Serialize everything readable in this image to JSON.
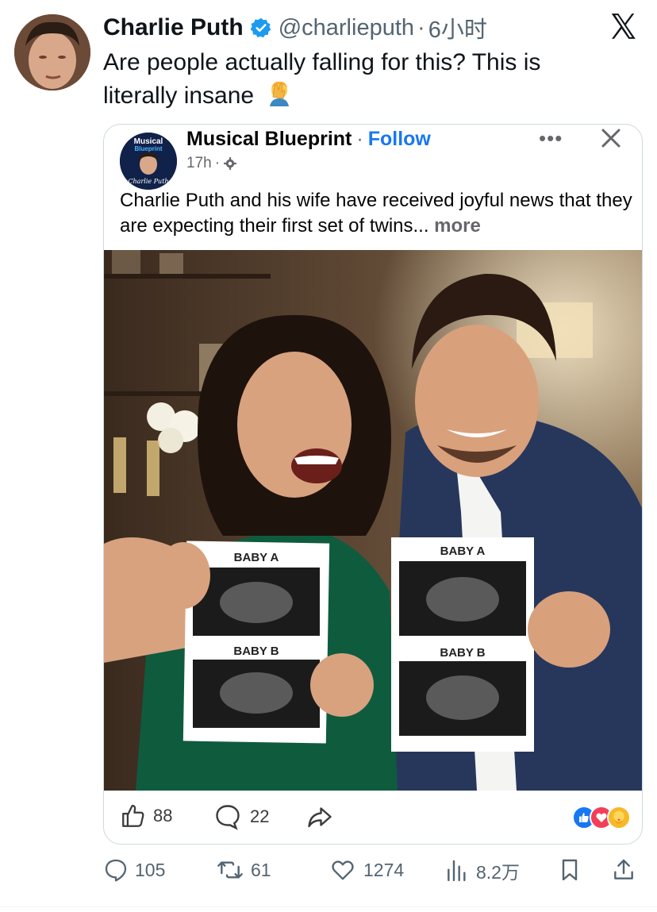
{
  "tweet": {
    "author_name": "Charlie Puth",
    "handle": "@charlieputh",
    "separator": "·",
    "time": "6小时",
    "text": "Are people actually falling for this? This is literally insane",
    "emoji": "facepalm-emoji"
  },
  "embedded_post": {
    "page_name": "Musical Blueprint",
    "separator": "·",
    "follow_label": "Follow",
    "time": "17h",
    "time_separator": "·",
    "more_menu": "•••",
    "text": "Charlie Puth and his wife have received joyful news that they are expecting their first set of twins...",
    "more_label": "more",
    "avatar_text_top": "Musical",
    "avatar_text_mid": "Blueprint",
    "avatar_text_bottom": "Charlie Puth",
    "photo": {
      "card_left_label_top": "BABY A",
      "card_left_label_bottom": "BABY B",
      "card_right_label_top": "BABY A",
      "card_right_label_bottom": "BABY B"
    },
    "likes": "88",
    "comments": "22",
    "reactions": [
      "like",
      "love",
      "care"
    ]
  },
  "actions": {
    "replies": "105",
    "retweets": "61",
    "likes": "1274",
    "views": "8.2万"
  },
  "colors": {
    "text": "#0f1419",
    "muted": "#536471",
    "verified": "#1d9bf0",
    "fb_blue": "#1877f2"
  }
}
